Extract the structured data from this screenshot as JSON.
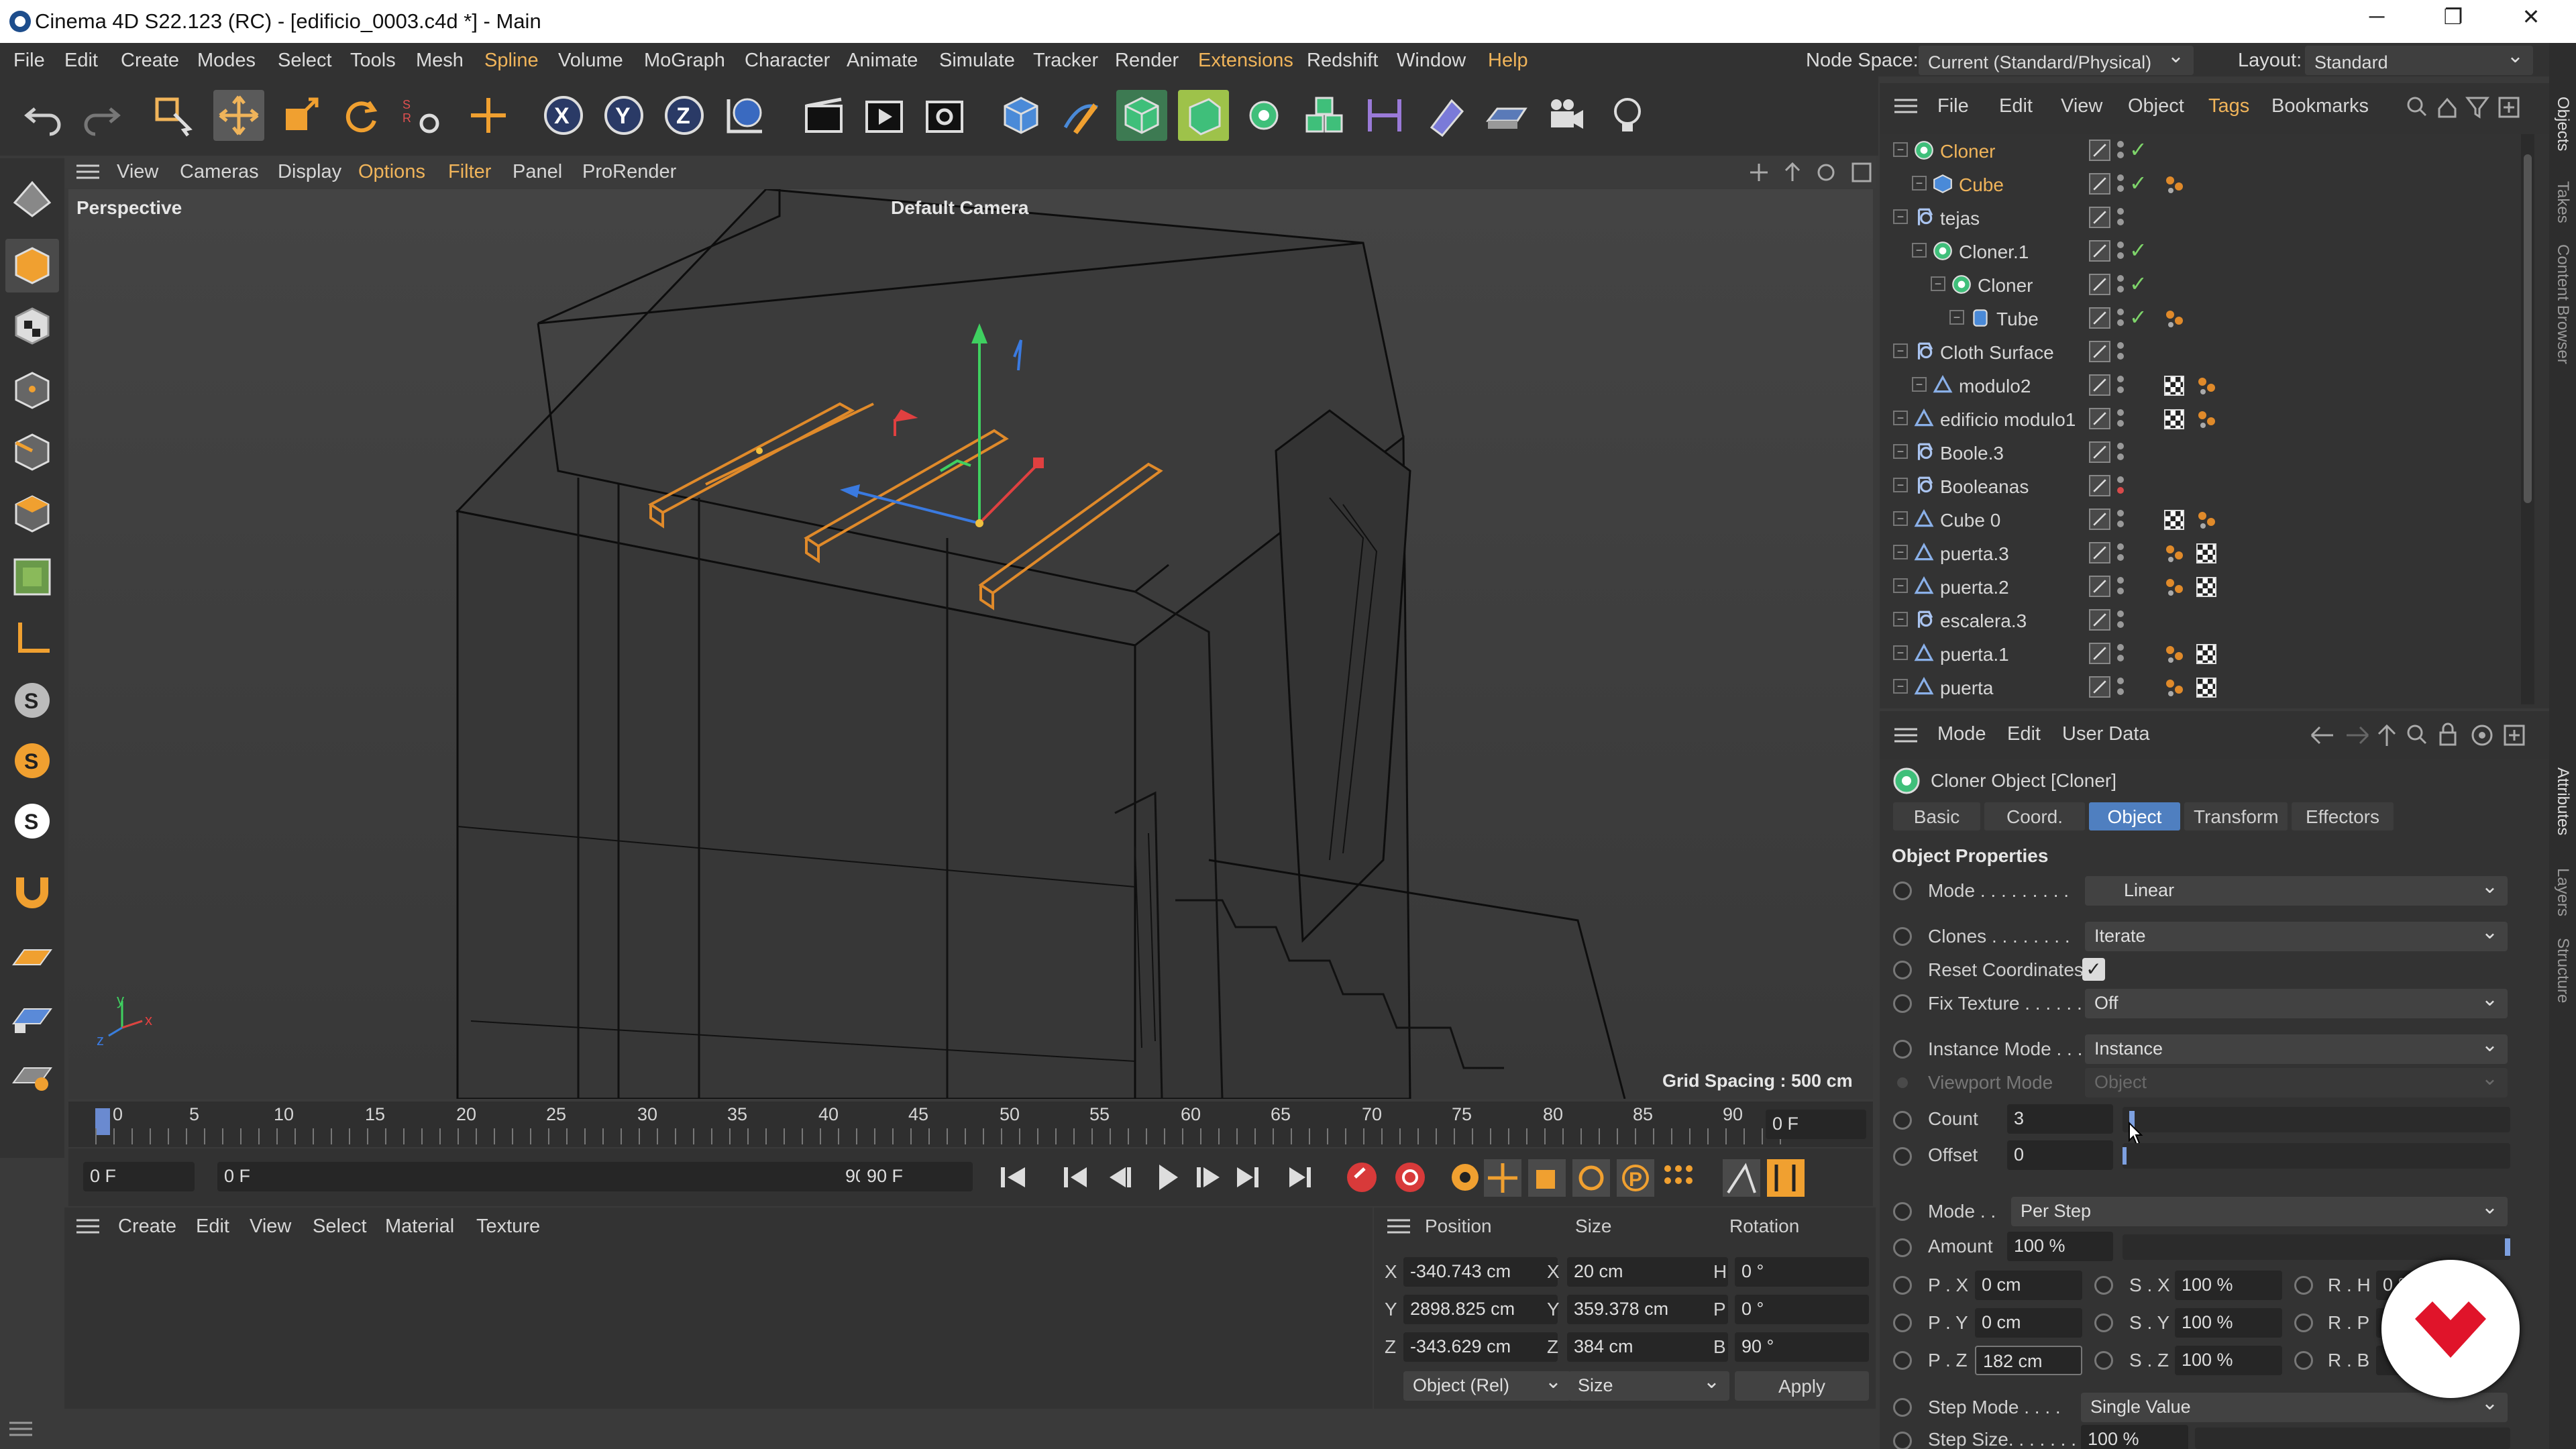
{
  "window": {
    "title": "Cinema 4D S22.123 (RC) - [edificio_0003.c4d *] - Main",
    "controls": [
      "─",
      "❐",
      "✕"
    ]
  },
  "menubar": {
    "items": [
      "File",
      "Edit",
      "Create",
      "Modes",
      "Select",
      "Tools",
      "Mesh",
      "Spline",
      "Volume",
      "MoGraph",
      "Character",
      "Animate",
      "Simulate",
      "Tracker",
      "Render",
      "Extensions",
      "Redshift",
      "Window",
      "Help"
    ],
    "node_space_label": "Node Space:",
    "node_space_value": "Current (Standard/Physical)",
    "layout_label": "Layout:",
    "layout_value": "Standard"
  },
  "viewport": {
    "menu": [
      "View",
      "Cameras",
      "Display",
      "Options",
      "Filter",
      "Panel",
      "ProRender"
    ],
    "label": "Perspective",
    "camera": "Default Camera",
    "grid_spacing": "Grid Spacing : 500 cm",
    "axis_labels": [
      "y",
      "z",
      "x"
    ]
  },
  "timeline": {
    "ticks": [
      "0",
      "5",
      "10",
      "15",
      "20",
      "25",
      "30",
      "35",
      "40",
      "45",
      "50",
      "55",
      "60",
      "65",
      "70",
      "75",
      "80",
      "85",
      "90"
    ],
    "current_frame": "0 F"
  },
  "playback": {
    "start": "0 F",
    "preview_start": "0 F",
    "preview_end": "90 F",
    "end": "90 F"
  },
  "material_manager": {
    "menu": [
      "Create",
      "Edit",
      "View",
      "Select",
      "Material",
      "Texture"
    ]
  },
  "coord_manager": {
    "headers": [
      "Position",
      "Size",
      "Rotation"
    ],
    "rows": [
      {
        "axis": "X",
        "pos": "-340.743 cm",
        "size_axis": "X",
        "size": "20 cm",
        "rot_axis": "H",
        "rot": "0 °"
      },
      {
        "axis": "Y",
        "pos": "2898.825 cm",
        "size_axis": "Y",
        "size": "359.378 cm",
        "rot_axis": "P",
        "rot": "0 °"
      },
      {
        "axis": "Z",
        "pos": "-343.629 cm",
        "size_axis": "Z",
        "size": "384 cm",
        "rot_axis": "B",
        "rot": "90 °"
      }
    ],
    "mode": "Object (Rel)",
    "size_mode": "Size",
    "apply": "Apply"
  },
  "object_manager": {
    "menu": [
      "File",
      "Edit",
      "View",
      "Object",
      "Tags",
      "Bookmarks"
    ],
    "objects": [
      {
        "name": "Cloner",
        "indent": 0,
        "color": "#f0b45a",
        "icon": "cloner-icon",
        "check": true,
        "tags": []
      },
      {
        "name": "Cube",
        "indent": 1,
        "color": "#f0b45a",
        "icon": "cube-icon",
        "check": true,
        "tags": [
          "dots"
        ]
      },
      {
        "name": "tejas",
        "indent": 0,
        "color": "#d6d6d6",
        "icon": "null-icon",
        "check": false,
        "tags": []
      },
      {
        "name": "Cloner.1",
        "indent": 1,
        "color": "#d6d6d6",
        "icon": "cloner-icon",
        "check": true,
        "tags": []
      },
      {
        "name": "Cloner",
        "indent": 2,
        "color": "#d6d6d6",
        "icon": "cloner-icon",
        "check": true,
        "tags": []
      },
      {
        "name": "Tube",
        "indent": 3,
        "color": "#d6d6d6",
        "icon": "tube-icon",
        "check": true,
        "tags": [
          "dots"
        ]
      },
      {
        "name": "Cloth Surface",
        "indent": 0,
        "color": "#d6d6d6",
        "icon": "null-icon",
        "check": false,
        "tags": []
      },
      {
        "name": "modulo2",
        "indent": 1,
        "color": "#d6d6d6",
        "icon": "poly-icon",
        "check": false,
        "tags": [
          "checker",
          "dots"
        ]
      },
      {
        "name": "edificio modulo1",
        "indent": 0,
        "color": "#d6d6d6",
        "icon": "poly-icon",
        "check": false,
        "tags": [
          "checker",
          "dots"
        ]
      },
      {
        "name": "Boole.3",
        "indent": 0,
        "color": "#d6d6d6",
        "icon": "null-icon",
        "check": false,
        "tags": []
      },
      {
        "name": "Booleanas",
        "indent": 0,
        "color": "#d6d6d6",
        "icon": "null-icon",
        "check": false,
        "tags": []
      },
      {
        "name": "Cube 0",
        "indent": 0,
        "color": "#d6d6d6",
        "icon": "poly-icon",
        "check": false,
        "tags": [
          "checker",
          "dots"
        ]
      },
      {
        "name": "puerta.3",
        "indent": 0,
        "color": "#d6d6d6",
        "icon": "poly-icon",
        "check": false,
        "tags": [
          "dots",
          "checker"
        ]
      },
      {
        "name": "puerta.2",
        "indent": 0,
        "color": "#d6d6d6",
        "icon": "poly-icon",
        "check": false,
        "tags": [
          "dots",
          "checker"
        ]
      },
      {
        "name": "escalera.3",
        "indent": 0,
        "color": "#d6d6d6",
        "icon": "null-icon",
        "check": false,
        "tags": []
      },
      {
        "name": "puerta.1",
        "indent": 0,
        "color": "#d6d6d6",
        "icon": "poly-icon",
        "check": false,
        "tags": [
          "dots",
          "checker"
        ]
      },
      {
        "name": "puerta",
        "indent": 0,
        "color": "#d6d6d6",
        "icon": "poly-icon",
        "check": false,
        "tags": [
          "dots",
          "checker"
        ]
      }
    ]
  },
  "attributes": {
    "menu": [
      "Mode",
      "Edit",
      "User Data"
    ],
    "object_title": "Cloner Object [Cloner]",
    "tabs": [
      "Basic",
      "Coord.",
      "Object",
      "Transform",
      "Effectors"
    ],
    "active_tab": "Object",
    "section": "Object Properties",
    "mode_label": "Mode . . . . . . . . .",
    "mode_value": "Linear",
    "clones_label": "Clones . . . . . . . .",
    "clones_value": "Iterate",
    "reset_label": "Reset Coordinates",
    "fix_label": "Fix Texture . . . . . .",
    "fix_value": "Off",
    "instance_label": "Instance Mode . . .",
    "instance_value": "Instance",
    "viewport_label": "Viewport Mode",
    "viewport_value": "Object",
    "count_label": "Count",
    "count_value": "3",
    "offset_label": "Offset",
    "offset_value": "0",
    "mode2_label": "Mode . .",
    "mode2_value": "Per Step",
    "amount_label": "Amount",
    "amount_value": "100 %",
    "px_label": "P . X",
    "px_value": "0 cm",
    "py_label": "P . Y",
    "py_value": "0 cm",
    "pz_label": "P . Z",
    "pz_value": "182 cm",
    "sx_label": "S . X",
    "sx_value": "100 %",
    "sy_label": "S . Y",
    "sy_value": "100 %",
    "sz_label": "S . Z",
    "sz_value": "100 %",
    "rh_label": "R . H",
    "rh_value": "0 °",
    "rp_label": "R . P",
    "rb_label": "R . B",
    "step_mode_label": "Step Mode . . . .",
    "step_mode_value": "Single Value",
    "step_size_label": "Step Size. . . . . . .",
    "step_size_value": "100 %"
  },
  "right_strip": [
    "Objects",
    "Takes",
    "Content Browser",
    "Attributes",
    "Layers",
    "Structure"
  ],
  "colors": {
    "accent_orange": "#f0b45a",
    "active_tab": "#4f7fc0",
    "selection": "#e08a2a",
    "green_check": "#7ed46a"
  }
}
